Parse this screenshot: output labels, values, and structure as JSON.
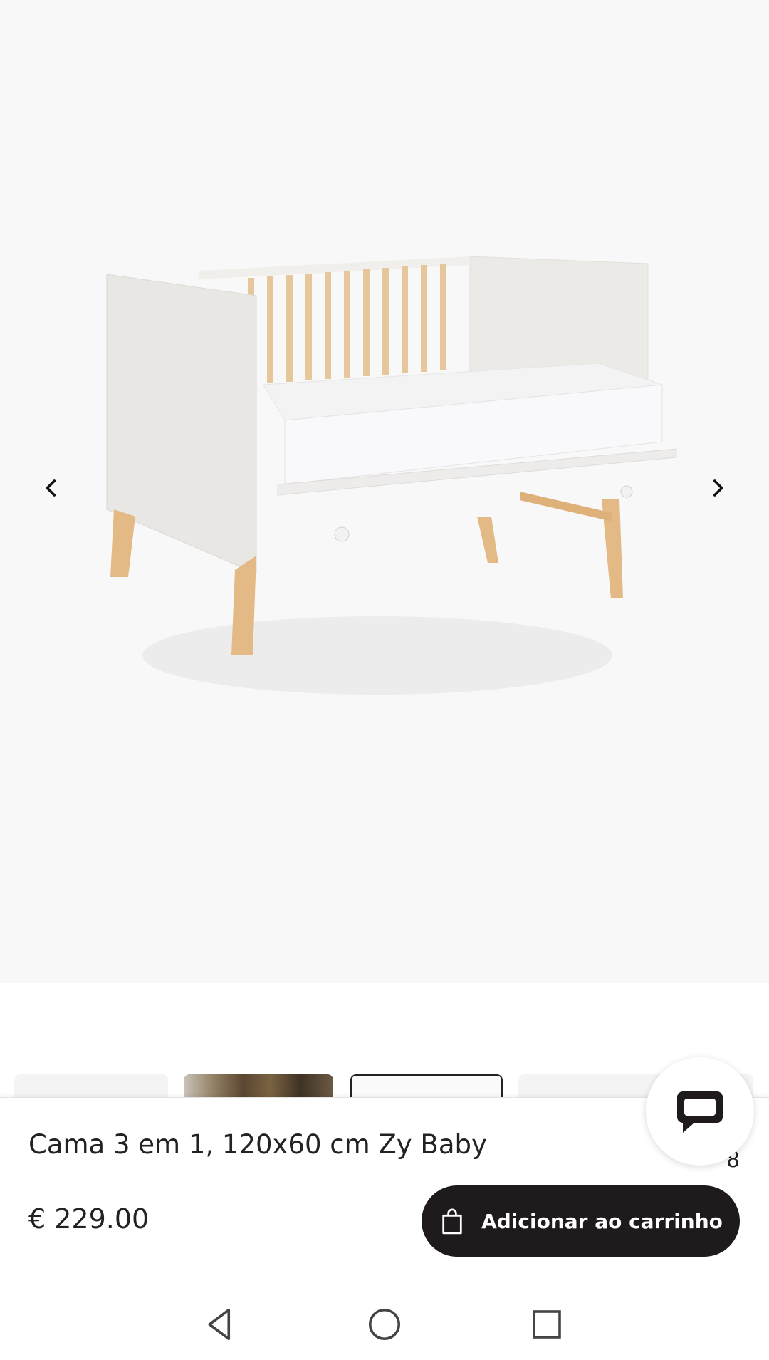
{
  "gallery": {
    "image_name": "crib-product-image",
    "prev_icon": "chevron-left-icon",
    "next_icon": "chevron-right-icon"
  },
  "thumbnails": [
    {
      "name": "thumb-1",
      "selected": false
    },
    {
      "name": "thumb-2",
      "selected": false
    },
    {
      "name": "thumb-3",
      "selected": true
    },
    {
      "name": "thumb-4",
      "selected": false
    }
  ],
  "product": {
    "title": "Cama 3 em 1, 120x60 cm Zy Baby",
    "price": "€ 229.00",
    "peek_text": "8"
  },
  "actions": {
    "add_to_cart_label": "Adicionar ao carrinho",
    "add_to_cart_icon": "shopping-bag-icon",
    "chat_icon": "chat-bubble-icon"
  },
  "colors": {
    "gallery_bg": "#f9f8f8",
    "button_bg": "#1f1b1c",
    "text": "#222222"
  },
  "system_nav": {
    "back_icon": "back-triangle-icon",
    "home_icon": "home-circle-icon",
    "recents_icon": "recents-square-icon"
  }
}
